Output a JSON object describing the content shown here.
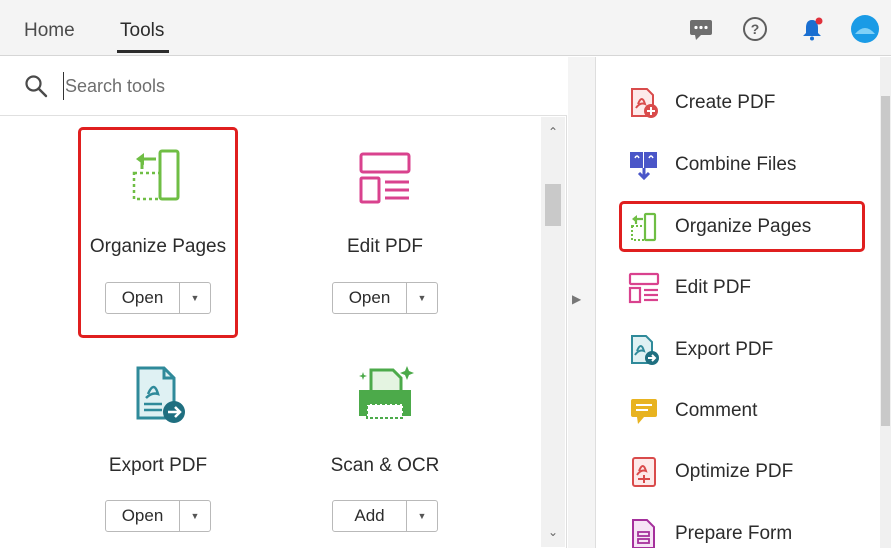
{
  "header": {
    "tabs": [
      {
        "label": "Home"
      },
      {
        "label": "Tools"
      }
    ],
    "icons": [
      "chat-icon",
      "help-icon",
      "notification-bell-icon",
      "user-avatar-icon"
    ]
  },
  "search": {
    "placeholder": "Search tools"
  },
  "tools_grid": {
    "cards": [
      {
        "name": "Organize Pages",
        "button": "Open",
        "icon": "organize-pages-icon"
      },
      {
        "name": "Edit PDF",
        "button": "Open",
        "icon": "edit-pdf-icon"
      },
      {
        "name": "Export PDF",
        "button": "Open",
        "icon": "export-pdf-icon"
      },
      {
        "name": "Scan & OCR",
        "button": "Add",
        "icon": "scan-ocr-icon"
      }
    ]
  },
  "right_panel": {
    "items": [
      {
        "label": "Create PDF",
        "icon": "create-pdf-icon"
      },
      {
        "label": "Combine Files",
        "icon": "combine-files-icon"
      },
      {
        "label": "Organize Pages",
        "icon": "organize-pages-icon"
      },
      {
        "label": "Edit PDF",
        "icon": "edit-pdf-icon"
      },
      {
        "label": "Export PDF",
        "icon": "export-pdf-icon"
      },
      {
        "label": "Comment",
        "icon": "comment-icon"
      },
      {
        "label": "Optimize PDF",
        "icon": "optimize-pdf-icon"
      },
      {
        "label": "Prepare Form",
        "icon": "prepare-form-icon"
      }
    ]
  },
  "colors": {
    "highlight": "#e01f1f",
    "organize_green": "#6fbe44",
    "edit_pink": "#d9428e",
    "export_teal": "#2f8a9a",
    "scan_green": "#4caa4a",
    "create_red": "#d94b4b",
    "combine_blue": "#4a56c8",
    "comment_yellow": "#e8b320",
    "avatar_blue": "#1a9be6"
  }
}
